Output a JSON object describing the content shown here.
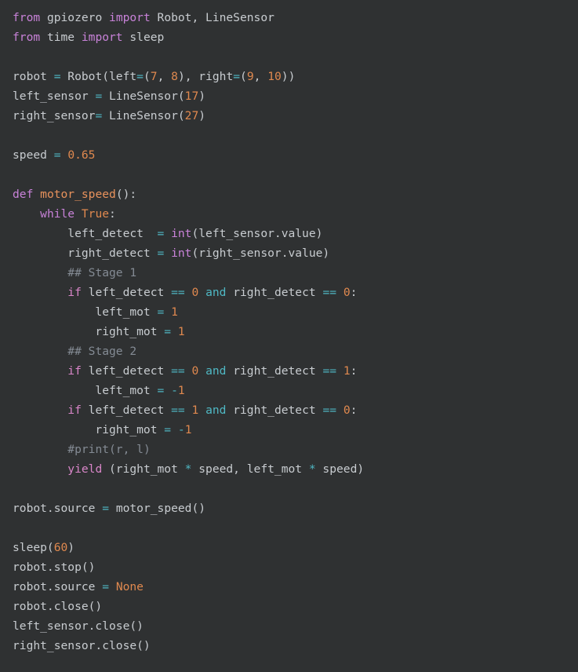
{
  "editor": {
    "language": "Python",
    "background_color": "#2f3132",
    "font_size_px": 14.6,
    "line_height_px": 25,
    "theme_colors": {
      "default_text": "#c8ccd0",
      "keyword": "#c882d8",
      "keyword_control": "#d986c9",
      "function_name": "#e8925c",
      "number": "#e0894f",
      "operator": "#4fb8c4",
      "comment": "#848b94",
      "constant": "#e0894f",
      "builtin": "#c882d8"
    }
  },
  "code": {
    "full_text": "from gpiozero import Robot, LineSensor\nfrom time import sleep\n\nrobot = Robot(left=(7, 8), right=(9, 10))\nleft_sensor = LineSensor(17)\nright_sensor= LineSensor(27)\n\nspeed = 0.65\n\ndef motor_speed():\n    while True:\n        left_detect  = int(left_sensor.value)\n        right_detect = int(right_sensor.value)\n        ## Stage 1\n        if left_detect == 0 and right_detect == 0:\n            left_mot = 1\n            right_mot = 1\n        ## Stage 2\n        if left_detect == 0 and right_detect == 1:\n            left_mot = -1\n        if left_detect == 1 and right_detect == 0:\n            right_mot = -1\n        #print(r, l)\n        yield (right_mot * speed, left_mot * speed)\n\nrobot.source = motor_speed()\n\nsleep(60)\nrobot.stop()\nrobot.source = None\nrobot.close()\nleft_sensor.close()\nright_sensor.close()",
    "lines": [
      {
        "n": 1,
        "tokens": [
          {
            "t": "from",
            "c": "kw"
          },
          {
            "t": " gpiozero ",
            "c": "plain"
          },
          {
            "t": "import",
            "c": "kw"
          },
          {
            "t": " Robot, LineSensor",
            "c": "plain"
          }
        ]
      },
      {
        "n": 2,
        "tokens": [
          {
            "t": "from",
            "c": "kw"
          },
          {
            "t": " time ",
            "c": "plain"
          },
          {
            "t": "import",
            "c": "kw"
          },
          {
            "t": " sleep",
            "c": "plain"
          }
        ]
      },
      {
        "n": 3,
        "tokens": []
      },
      {
        "n": 4,
        "tokens": [
          {
            "t": "robot ",
            "c": "plain"
          },
          {
            "t": "=",
            "c": "op"
          },
          {
            "t": " Robot(left",
            "c": "plain"
          },
          {
            "t": "=",
            "c": "op"
          },
          {
            "t": "(",
            "c": "plain"
          },
          {
            "t": "7",
            "c": "num"
          },
          {
            "t": ", ",
            "c": "plain"
          },
          {
            "t": "8",
            "c": "num"
          },
          {
            "t": "), right",
            "c": "plain"
          },
          {
            "t": "=",
            "c": "op"
          },
          {
            "t": "(",
            "c": "plain"
          },
          {
            "t": "9",
            "c": "num"
          },
          {
            "t": ", ",
            "c": "plain"
          },
          {
            "t": "10",
            "c": "num"
          },
          {
            "t": "))",
            "c": "plain"
          }
        ]
      },
      {
        "n": 5,
        "tokens": [
          {
            "t": "left_sensor ",
            "c": "plain"
          },
          {
            "t": "=",
            "c": "op"
          },
          {
            "t": " LineSensor(",
            "c": "plain"
          },
          {
            "t": "17",
            "c": "num"
          },
          {
            "t": ")",
            "c": "plain"
          }
        ]
      },
      {
        "n": 6,
        "tokens": [
          {
            "t": "right_sensor",
            "c": "plain"
          },
          {
            "t": "=",
            "c": "op"
          },
          {
            "t": " LineSensor(",
            "c": "plain"
          },
          {
            "t": "27",
            "c": "num"
          },
          {
            "t": ")",
            "c": "plain"
          }
        ]
      },
      {
        "n": 7,
        "tokens": []
      },
      {
        "n": 8,
        "tokens": [
          {
            "t": "speed ",
            "c": "plain"
          },
          {
            "t": "=",
            "c": "op"
          },
          {
            "t": " ",
            "c": "plain"
          },
          {
            "t": "0.65",
            "c": "num"
          }
        ]
      },
      {
        "n": 9,
        "tokens": []
      },
      {
        "n": 10,
        "tokens": [
          {
            "t": "def",
            "c": "kw"
          },
          {
            "t": " ",
            "c": "plain"
          },
          {
            "t": "motor_speed",
            "c": "fn"
          },
          {
            "t": "():",
            "c": "plain"
          }
        ]
      },
      {
        "n": 11,
        "tokens": [
          {
            "t": "    ",
            "c": "plain"
          },
          {
            "t": "while",
            "c": "kw"
          },
          {
            "t": " ",
            "c": "plain"
          },
          {
            "t": "True",
            "c": "const"
          },
          {
            "t": ":",
            "c": "plain"
          }
        ]
      },
      {
        "n": 12,
        "tokens": [
          {
            "t": "        left_detect  ",
            "c": "plain"
          },
          {
            "t": "=",
            "c": "op"
          },
          {
            "t": " ",
            "c": "plain"
          },
          {
            "t": "int",
            "c": "builtin"
          },
          {
            "t": "(left_sensor.value)",
            "c": "plain"
          }
        ]
      },
      {
        "n": 13,
        "tokens": [
          {
            "t": "        right_detect ",
            "c": "plain"
          },
          {
            "t": "=",
            "c": "op"
          },
          {
            "t": " ",
            "c": "plain"
          },
          {
            "t": "int",
            "c": "builtin"
          },
          {
            "t": "(right_sensor.value)",
            "c": "plain"
          }
        ]
      },
      {
        "n": 14,
        "tokens": [
          {
            "t": "        ",
            "c": "plain"
          },
          {
            "t": "## Stage 1",
            "c": "cmt"
          }
        ]
      },
      {
        "n": 15,
        "tokens": [
          {
            "t": "        ",
            "c": "plain"
          },
          {
            "t": "if",
            "c": "kw2"
          },
          {
            "t": " left_detect ",
            "c": "plain"
          },
          {
            "t": "==",
            "c": "op"
          },
          {
            "t": " ",
            "c": "plain"
          },
          {
            "t": "0",
            "c": "num"
          },
          {
            "t": " ",
            "c": "plain"
          },
          {
            "t": "and",
            "c": "op"
          },
          {
            "t": " right_detect ",
            "c": "plain"
          },
          {
            "t": "==",
            "c": "op"
          },
          {
            "t": " ",
            "c": "plain"
          },
          {
            "t": "0",
            "c": "num"
          },
          {
            "t": ":",
            "c": "plain"
          }
        ]
      },
      {
        "n": 16,
        "tokens": [
          {
            "t": "            left_mot ",
            "c": "plain"
          },
          {
            "t": "=",
            "c": "op"
          },
          {
            "t": " ",
            "c": "plain"
          },
          {
            "t": "1",
            "c": "num"
          }
        ]
      },
      {
        "n": 17,
        "tokens": [
          {
            "t": "            right_mot ",
            "c": "plain"
          },
          {
            "t": "=",
            "c": "op"
          },
          {
            "t": " ",
            "c": "plain"
          },
          {
            "t": "1",
            "c": "num"
          }
        ]
      },
      {
        "n": 18,
        "tokens": [
          {
            "t": "        ",
            "c": "plain"
          },
          {
            "t": "## Stage 2",
            "c": "cmt"
          }
        ]
      },
      {
        "n": 19,
        "tokens": [
          {
            "t": "        ",
            "c": "plain"
          },
          {
            "t": "if",
            "c": "kw2"
          },
          {
            "t": " left_detect ",
            "c": "plain"
          },
          {
            "t": "==",
            "c": "op"
          },
          {
            "t": " ",
            "c": "plain"
          },
          {
            "t": "0",
            "c": "num"
          },
          {
            "t": " ",
            "c": "plain"
          },
          {
            "t": "and",
            "c": "op"
          },
          {
            "t": " right_detect ",
            "c": "plain"
          },
          {
            "t": "==",
            "c": "op"
          },
          {
            "t": " ",
            "c": "plain"
          },
          {
            "t": "1",
            "c": "num"
          },
          {
            "t": ":",
            "c": "plain"
          }
        ]
      },
      {
        "n": 20,
        "tokens": [
          {
            "t": "            left_mot ",
            "c": "plain"
          },
          {
            "t": "=",
            "c": "op"
          },
          {
            "t": " ",
            "c": "plain"
          },
          {
            "t": "-",
            "c": "op"
          },
          {
            "t": "1",
            "c": "num"
          }
        ]
      },
      {
        "n": 21,
        "tokens": [
          {
            "t": "        ",
            "c": "plain"
          },
          {
            "t": "if",
            "c": "kw2"
          },
          {
            "t": " left_detect ",
            "c": "plain"
          },
          {
            "t": "==",
            "c": "op"
          },
          {
            "t": " ",
            "c": "plain"
          },
          {
            "t": "1",
            "c": "num"
          },
          {
            "t": " ",
            "c": "plain"
          },
          {
            "t": "and",
            "c": "op"
          },
          {
            "t": " right_detect ",
            "c": "plain"
          },
          {
            "t": "==",
            "c": "op"
          },
          {
            "t": " ",
            "c": "plain"
          },
          {
            "t": "0",
            "c": "num"
          },
          {
            "t": ":",
            "c": "plain"
          }
        ]
      },
      {
        "n": 22,
        "tokens": [
          {
            "t": "            right_mot ",
            "c": "plain"
          },
          {
            "t": "=",
            "c": "op"
          },
          {
            "t": " ",
            "c": "plain"
          },
          {
            "t": "-",
            "c": "op"
          },
          {
            "t": "1",
            "c": "num"
          }
        ]
      },
      {
        "n": 23,
        "tokens": [
          {
            "t": "        ",
            "c": "plain"
          },
          {
            "t": "#print(r, l)",
            "c": "cmt"
          }
        ]
      },
      {
        "n": 24,
        "tokens": [
          {
            "t": "        ",
            "c": "plain"
          },
          {
            "t": "yield",
            "c": "kw2"
          },
          {
            "t": " (right_mot ",
            "c": "plain"
          },
          {
            "t": "*",
            "c": "op"
          },
          {
            "t": " speed, left_mot ",
            "c": "plain"
          },
          {
            "t": "*",
            "c": "op"
          },
          {
            "t": " speed)",
            "c": "plain"
          }
        ]
      },
      {
        "n": 25,
        "tokens": []
      },
      {
        "n": 26,
        "tokens": [
          {
            "t": "robot.source ",
            "c": "plain"
          },
          {
            "t": "=",
            "c": "op"
          },
          {
            "t": " motor_speed()",
            "c": "plain"
          }
        ]
      },
      {
        "n": 27,
        "tokens": []
      },
      {
        "n": 28,
        "tokens": [
          {
            "t": "sleep(",
            "c": "plain"
          },
          {
            "t": "60",
            "c": "num"
          },
          {
            "t": ")",
            "c": "plain"
          }
        ]
      },
      {
        "n": 29,
        "tokens": [
          {
            "t": "robot.stop()",
            "c": "plain"
          }
        ]
      },
      {
        "n": 30,
        "tokens": [
          {
            "t": "robot.source ",
            "c": "plain"
          },
          {
            "t": "=",
            "c": "op"
          },
          {
            "t": " ",
            "c": "plain"
          },
          {
            "t": "None",
            "c": "const"
          }
        ]
      },
      {
        "n": 31,
        "tokens": [
          {
            "t": "robot.close()",
            "c": "plain"
          }
        ]
      },
      {
        "n": 32,
        "tokens": [
          {
            "t": "left_sensor.close()",
            "c": "plain"
          }
        ]
      },
      {
        "n": 33,
        "tokens": [
          {
            "t": "right_sensor.close()",
            "c": "plain"
          }
        ]
      }
    ]
  }
}
